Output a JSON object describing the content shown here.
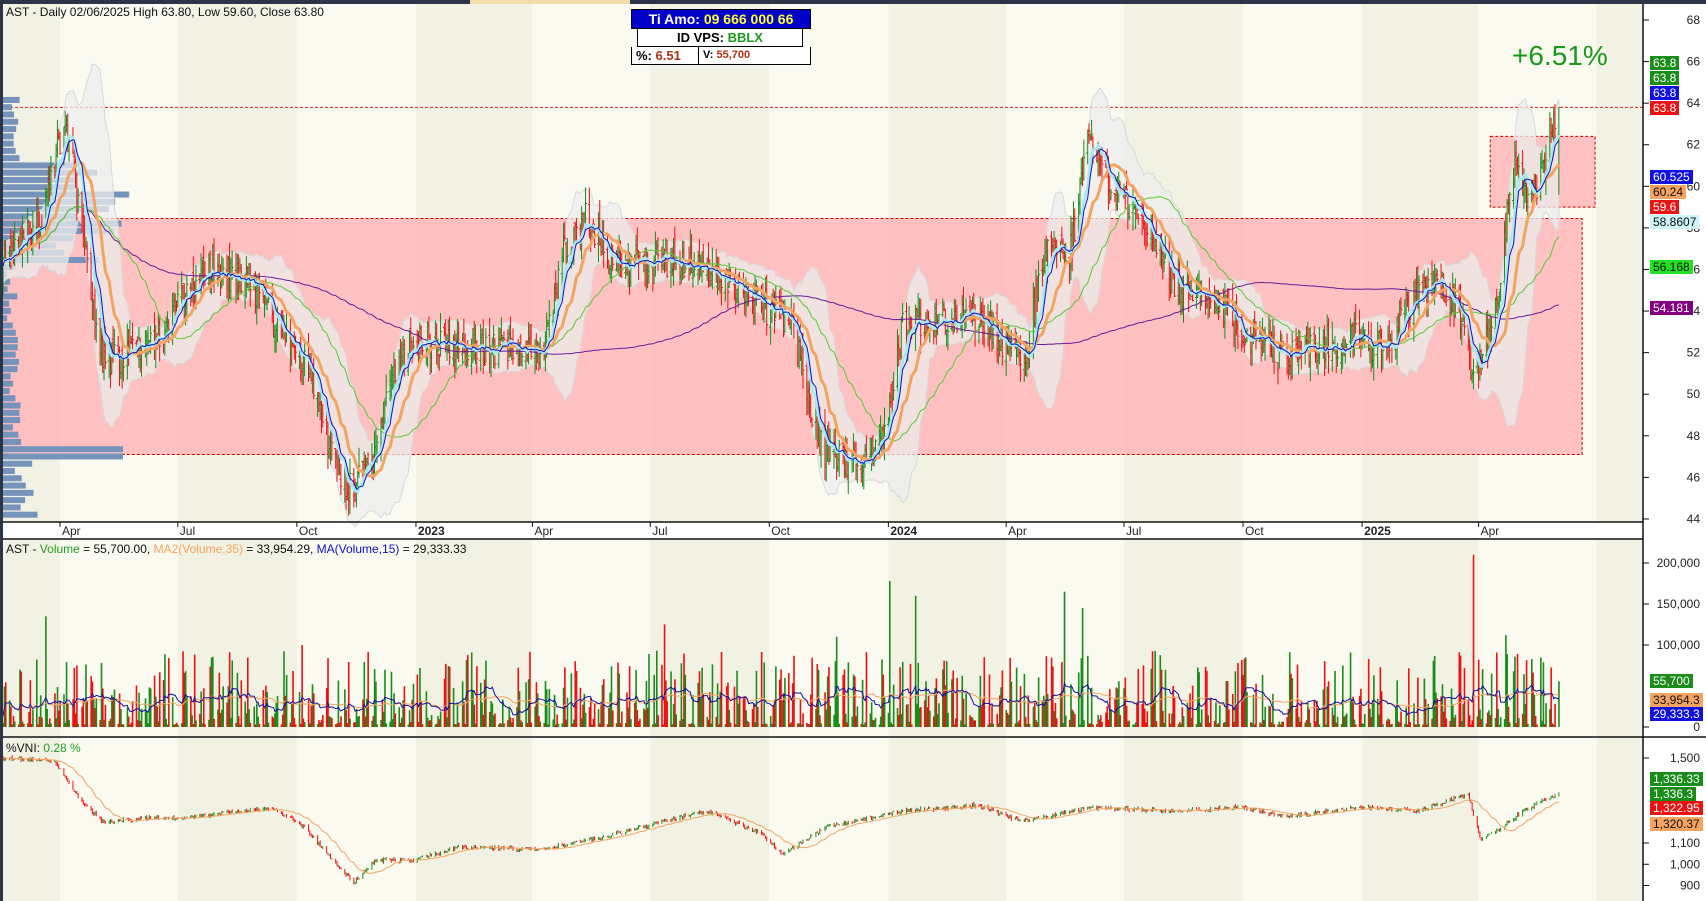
{
  "header": {
    "title": "AST - Daily 02/06/2025 High 63.80, Low 59.60, Close 63.80"
  },
  "info_box": {
    "phone_label": "Ti Amo:",
    "phone": "09 666 000 66",
    "id_label": "ID VPS:",
    "id_value": "BBLX",
    "pct_label": "%:",
    "pct_value": "6.51",
    "vol_label": "V:",
    "vol_value": "55,700"
  },
  "change_label": "+6.51%",
  "volume_legend": {
    "prefix": "AST - ",
    "vol_name": "Volume",
    "vol_val": " = 55,700.00, ",
    "ma35_name": "MA2(Volume,35)",
    "ma35_val": " = 33,954.29, ",
    "ma15_name": "MA(Volume,15)",
    "ma15_val": " = 29,333.33"
  },
  "vni_legend": {
    "name": "%VNI: ",
    "value": "0.28 %"
  },
  "price_tags": [
    {
      "label": "63.8",
      "color": "#1a8c1a"
    },
    {
      "label": "63.8",
      "color": "#1a8c1a"
    },
    {
      "label": "63.8",
      "color": "#1010e0"
    },
    {
      "label": "63.8",
      "color": "#ee1111"
    },
    {
      "label": "60.525",
      "color": "#1010e0"
    },
    {
      "label": "60.24",
      "color": "#f4a460"
    },
    {
      "label": "59.6",
      "color": "#ee1111"
    },
    {
      "label": "58.8607",
      "color": "#cdf3f7"
    },
    {
      "label": "56.168",
      "color": "#22e022"
    },
    {
      "label": "54.181",
      "color": "#800080"
    }
  ],
  "volume_tags": [
    {
      "label": "55,700",
      "color": "#1a8c1a"
    },
    {
      "label": "33,954.3",
      "color": "#f4a460"
    },
    {
      "label": "29,333.3",
      "color": "#1010e0"
    }
  ],
  "vni_tags": [
    {
      "label": "1,336.33",
      "color": "#1a8c1a"
    },
    {
      "label": "1,336.3",
      "color": "#1a8c1a"
    },
    {
      "label": "1,322.95",
      "color": "#ee1111"
    },
    {
      "label": "1,320.37",
      "color": "#f4a460"
    }
  ],
  "colors": {
    "up": "#1a8c1a",
    "down": "#ee1111",
    "zone": "#ffb6b9",
    "zone_border": "#cc0000"
  },
  "chart_data": [
    {
      "type": "candlestick",
      "title": "AST - Daily",
      "x_ticks": [
        "Apr",
        "Jul",
        "Oct",
        "2023",
        "Apr",
        "Jul",
        "Oct",
        "2024",
        "Apr",
        "Jul",
        "Oct",
        "2025",
        "Apr"
      ],
      "x_tick_dates": [
        "2022-04-01",
        "2022-07-01",
        "2022-10-01",
        "2023-01-01",
        "2023-04-01",
        "2023-07-01",
        "2023-10-01",
        "2024-01-01",
        "2024-04-01",
        "2024-07-01",
        "2024-10-01",
        "2025-01-01",
        "2025-04-01"
      ],
      "y_ticks": [
        "44",
        "46",
        "48",
        "50",
        "52",
        "54",
        "56",
        "58",
        "60",
        "62",
        "64",
        "66",
        "68"
      ],
      "ylim": [
        44,
        68
      ],
      "close_keypoints": [
        [
          "2022-02-21",
          56.4
        ],
        [
          "2022-03-18",
          58.5
        ],
        [
          "2022-04-05",
          63.2
        ],
        [
          "2022-04-17",
          58.5
        ],
        [
          "2022-05-04",
          51.7
        ],
        [
          "2022-05-16",
          51.7
        ],
        [
          "2022-06-18",
          53
        ],
        [
          "2022-07-22",
          55.9
        ],
        [
          "2022-08-25",
          55.6
        ],
        [
          "2022-09-20",
          52.7
        ],
        [
          "2022-10-07",
          51.7
        ],
        [
          "2022-10-24",
          48
        ],
        [
          "2022-11-10",
          45.4
        ],
        [
          "2022-11-27",
          46.4
        ],
        [
          "2022-12-13",
          50.6
        ],
        [
          "2022-12-30",
          52.7
        ],
        [
          "2023-02-03",
          52.2
        ],
        [
          "2023-03-06",
          52.2
        ],
        [
          "2023-04-09",
          52.2
        ],
        [
          "2023-04-26",
          56.9
        ],
        [
          "2023-05-12",
          58.5
        ],
        [
          "2023-06-06",
          56.1
        ],
        [
          "2023-07-10",
          56.4
        ],
        [
          "2023-08-05",
          56.4
        ],
        [
          "2023-08-30",
          55.3
        ],
        [
          "2023-09-24",
          54.3
        ],
        [
          "2023-10-19",
          53.2
        ],
        [
          "2023-11-10",
          47.5
        ],
        [
          "2023-12-09",
          46.4
        ],
        [
          "2023-12-30",
          48
        ],
        [
          "2024-01-12",
          53.2
        ],
        [
          "2024-02-06",
          53.8
        ],
        [
          "2024-03-02",
          53.8
        ],
        [
          "2024-03-27",
          52.7
        ],
        [
          "2024-04-17",
          51.7
        ],
        [
          "2024-04-30",
          56.9
        ],
        [
          "2024-05-21",
          56.9
        ],
        [
          "2024-06-03",
          62.2
        ],
        [
          "2024-06-20",
          60.1
        ],
        [
          "2024-07-15",
          58.5
        ],
        [
          "2024-08-10",
          55.3
        ],
        [
          "2024-09-13",
          54.3
        ],
        [
          "2024-10-08",
          52.7
        ],
        [
          "2024-11-02",
          51.7
        ],
        [
          "2024-11-28",
          52.2
        ],
        [
          "2024-12-23",
          52.7
        ],
        [
          "2025-01-17",
          52.2
        ],
        [
          "2025-02-12",
          54.8
        ],
        [
          "2025-03-03",
          55.3
        ],
        [
          "2025-03-15",
          54.3
        ],
        [
          "2025-03-28",
          50.6
        ],
        [
          "2025-04-06",
          52.2
        ],
        [
          "2025-04-18",
          54.8
        ],
        [
          "2025-04-26",
          61.1
        ],
        [
          "2025-05-05",
          60.3
        ],
        [
          "2025-05-14",
          59.5
        ],
        [
          "2025-06-02",
          63.8
        ]
      ],
      "last": {
        "date": "2025-06-02",
        "high": 63.8,
        "low": 59.6,
        "close": 63.8
      },
      "moving_averages": [
        {
          "name": "MA blue",
          "value": 60.525
        },
        {
          "name": "MA orange",
          "value": 60.24
        },
        {
          "name": "MA cyan",
          "value": 58.8607
        },
        {
          "name": "MA green",
          "value": 56.168
        },
        {
          "name": "MA purple",
          "value": 54.181
        }
      ],
      "zones": [
        {
          "from": "2022-02-14",
          "to": "2025-06-20",
          "low": 47.1,
          "high": 58.45
        },
        {
          "from": "2025-04-10",
          "to": "2025-06-30",
          "low": 59.0,
          "high": 62.4
        }
      ],
      "resistance_line": 63.8
    },
    {
      "type": "bar",
      "title": "Volume",
      "y_ticks": [
        "0",
        "100,000",
        "150,000",
        "200,000"
      ],
      "ylim": [
        0,
        220000
      ],
      "last_volume": 55700,
      "spikes": [
        [
          "2025-03-28",
          210000,
          "down"
        ],
        [
          "2024-01-02",
          178000,
          "up"
        ],
        [
          "2024-01-22",
          160000,
          "up"
        ],
        [
          "2024-05-16",
          165000,
          "up"
        ],
        [
          "2024-05-30",
          145000,
          "up"
        ],
        [
          "2022-03-20",
          135000,
          "up"
        ],
        [
          "2023-07-12",
          125000,
          "down"
        ],
        [
          "2025-04-22",
          112000,
          "up"
        ],
        [
          "2022-10-05",
          100000,
          "down"
        ],
        [
          "2023-11-22",
          110000,
          "up"
        ]
      ]
    },
    {
      "type": "line",
      "title": "%VNI",
      "y_ticks": [
        "900",
        "1,000",
        "1,100",
        "1,500"
      ],
      "ylim": [
        880,
        1520
      ],
      "keypoints": [
        [
          "2022-02-20",
          1500
        ],
        [
          "2022-03-27",
          1485
        ],
        [
          "2022-04-17",
          1303
        ],
        [
          "2022-05-04",
          1200
        ],
        [
          "2022-06-03",
          1215
        ],
        [
          "2022-07-14",
          1225
        ],
        [
          "2022-09-12",
          1267
        ],
        [
          "2022-10-07",
          1173
        ],
        [
          "2022-11-02",
          992
        ],
        [
          "2022-11-14",
          915
        ],
        [
          "2022-12-01",
          1018
        ],
        [
          "2022-12-30",
          1018
        ],
        [
          "2023-02-03",
          1080
        ],
        [
          "2023-04-09",
          1070
        ],
        [
          "2023-05-21",
          1122
        ],
        [
          "2023-08-13",
          1251
        ],
        [
          "2023-09-24",
          1148
        ],
        [
          "2023-10-11",
          1044
        ],
        [
          "2023-11-14",
          1174
        ],
        [
          "2024-01-12",
          1251
        ],
        [
          "2024-03-10",
          1277
        ],
        [
          "2024-04-13",
          1200
        ],
        [
          "2024-06-03",
          1267
        ],
        [
          "2024-08-10",
          1251
        ],
        [
          "2024-09-29",
          1267
        ],
        [
          "2024-11-02",
          1225
        ],
        [
          "2025-01-01",
          1267
        ],
        [
          "2025-02-12",
          1251
        ],
        [
          "2025-03-24",
          1329
        ],
        [
          "2025-03-28",
          1236
        ],
        [
          "2025-04-02",
          1122
        ],
        [
          "2025-04-14",
          1148
        ],
        [
          "2025-05-05",
          1251
        ],
        [
          "2025-06-02",
          1336.3
        ]
      ]
    }
  ]
}
